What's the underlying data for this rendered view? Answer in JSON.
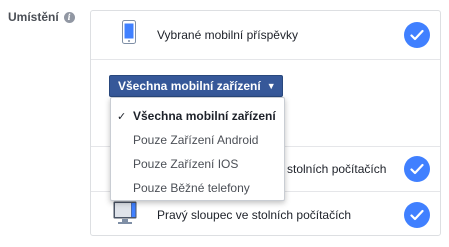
{
  "placement": {
    "label": "Umístění",
    "info_icon": "i"
  },
  "rows": [
    {
      "label": "Vybrané mobilní příspěvky",
      "icon": "mobile-phone-icon",
      "checked": true
    },
    {
      "label": "stolních počítačích",
      "checked": true
    },
    {
      "label": "Pravý sloupec ve stolních počítačích",
      "icon": "desktop-monitor-icon",
      "checked": true
    }
  ],
  "device_dropdown": {
    "label": "Všechna mobilní zařízení",
    "options": [
      {
        "label": "Všechna mobilní zařízení",
        "selected": true
      },
      {
        "label": "Pouze Zařízení Android",
        "selected": false
      },
      {
        "label": "Pouze Zařízení IOS",
        "selected": false
      },
      {
        "label": "Pouze Běžné telefony",
        "selected": false
      }
    ]
  },
  "colors": {
    "accent": "#4080ff",
    "button": "#365899"
  }
}
